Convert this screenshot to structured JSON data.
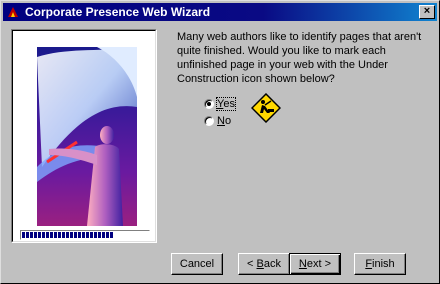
{
  "window": {
    "title": "Corporate Presence Web Wizard",
    "close_label": "×"
  },
  "progress": {
    "fraction": 0.72
  },
  "question": {
    "text": "Many web authors like to identify pages that aren't quite finished. Would you like to mark each unfinished page in your web with the Under Construction icon shown below?"
  },
  "options": {
    "yes": {
      "prefix": "",
      "mnemonic": "Y",
      "rest": "es",
      "checked": true
    },
    "no": {
      "prefix": "",
      "mnemonic": "N",
      "rest": "o",
      "checked": false
    }
  },
  "buttons": {
    "cancel": {
      "label": "Cancel"
    },
    "back": {
      "arrow": "<",
      "mnemonic": "B",
      "rest": "ack"
    },
    "next": {
      "mnemonic": "N",
      "rest": "ext",
      "arrow": ">"
    },
    "finish": {
      "mnemonic": "F",
      "rest": "inish"
    }
  },
  "colors": {
    "titlebar": "#000080",
    "face": "#c0c0c0",
    "uc_sign": "#ffd800"
  },
  "icons": {
    "app": "wizard-app-icon",
    "construction": "under-construction-icon"
  }
}
